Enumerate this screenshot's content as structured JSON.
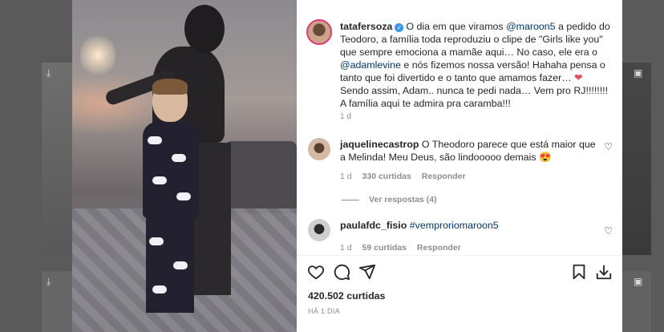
{
  "post": {
    "author": "tatafersoza",
    "caption_parts": {
      "p1": "O dia em que viramos ",
      "mention1": "@maroon5",
      "p2": " a pedido do Teodoro, a família toda reproduziu o clipe de \"Girls like you\" que sempre emociona a mamãe aqui… No caso, ele era o ",
      "mention2": "@adamlevine",
      "p3": " e nós fizemos nossa versão! Hahaha pensa o tanto que foi divertido e o tanto que amamos fazer… ",
      "p4": "Sendo assim, Adam.. nunca te pedi nada… Vem pro RJ!!!!!!!! A família aqui te admira pra caramba!!!"
    },
    "caption_time": "1 d",
    "likes": "420.502 curtidas",
    "date": "HÁ 1 DIA"
  },
  "comments": [
    {
      "username": "jaquelinecastrop",
      "text": "O Theodoro parece que está maior que a Melinda! Meu Deus, são lindooooo demais 😍",
      "time": "1 d",
      "likes": "330 curtidas",
      "reply": "Responder",
      "view_replies": "Ver respostas (4)"
    },
    {
      "username": "paulafdc_fisio",
      "text": "#vemproriomaroon5",
      "time": "1 d",
      "likes": "59 curtidas",
      "reply": "Responder"
    }
  ],
  "icons": {
    "verified": "verified-badge-icon",
    "heart": "heart-icon",
    "comment": "comment-icon",
    "share": "share-icon",
    "save": "save-icon",
    "download": "download-icon",
    "reel": "reel-icon"
  },
  "colors": {
    "link": "#00376b",
    "verified": "#3897f0",
    "heart": "#ed4956",
    "story_ring": "#e23b6f",
    "meta": "#8e8e8e"
  }
}
